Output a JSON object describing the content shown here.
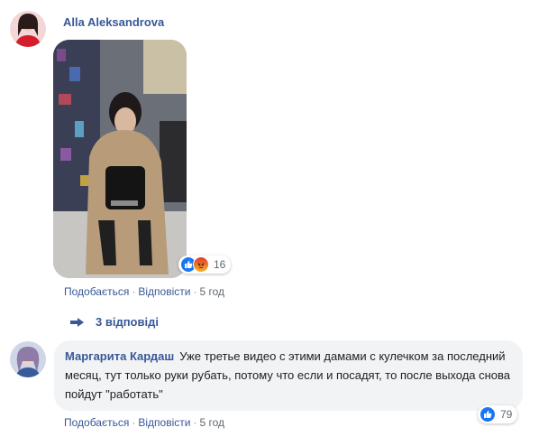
{
  "comment1": {
    "author": "Alla Aleksandrova",
    "reaction_count": "16",
    "reaction_icons": [
      "like-icon",
      "angry-icon"
    ],
    "actions": {
      "like": "Подобається",
      "reply": "Відповісти",
      "time": "5 год"
    },
    "replies_label": "3 відповіді"
  },
  "comment2": {
    "author": "Маргарита Кардаш",
    "text": "Уже третье видео с этими дамами с кулечком за последний месяц, тут только руки рубать, потому что если и посадят, то после выхода снова пойдут \"работать\"",
    "reaction_count": "79",
    "reaction_icons": [
      "like-icon"
    ],
    "actions": {
      "like": "Подобається",
      "reply": "Відповісти",
      "time": "5 год"
    }
  },
  "colors": {
    "link": "#385898",
    "meta": "#616770",
    "bubble": "#f2f3f5",
    "like_blue": "#1877f2",
    "angry_orange": "#e9710f"
  }
}
